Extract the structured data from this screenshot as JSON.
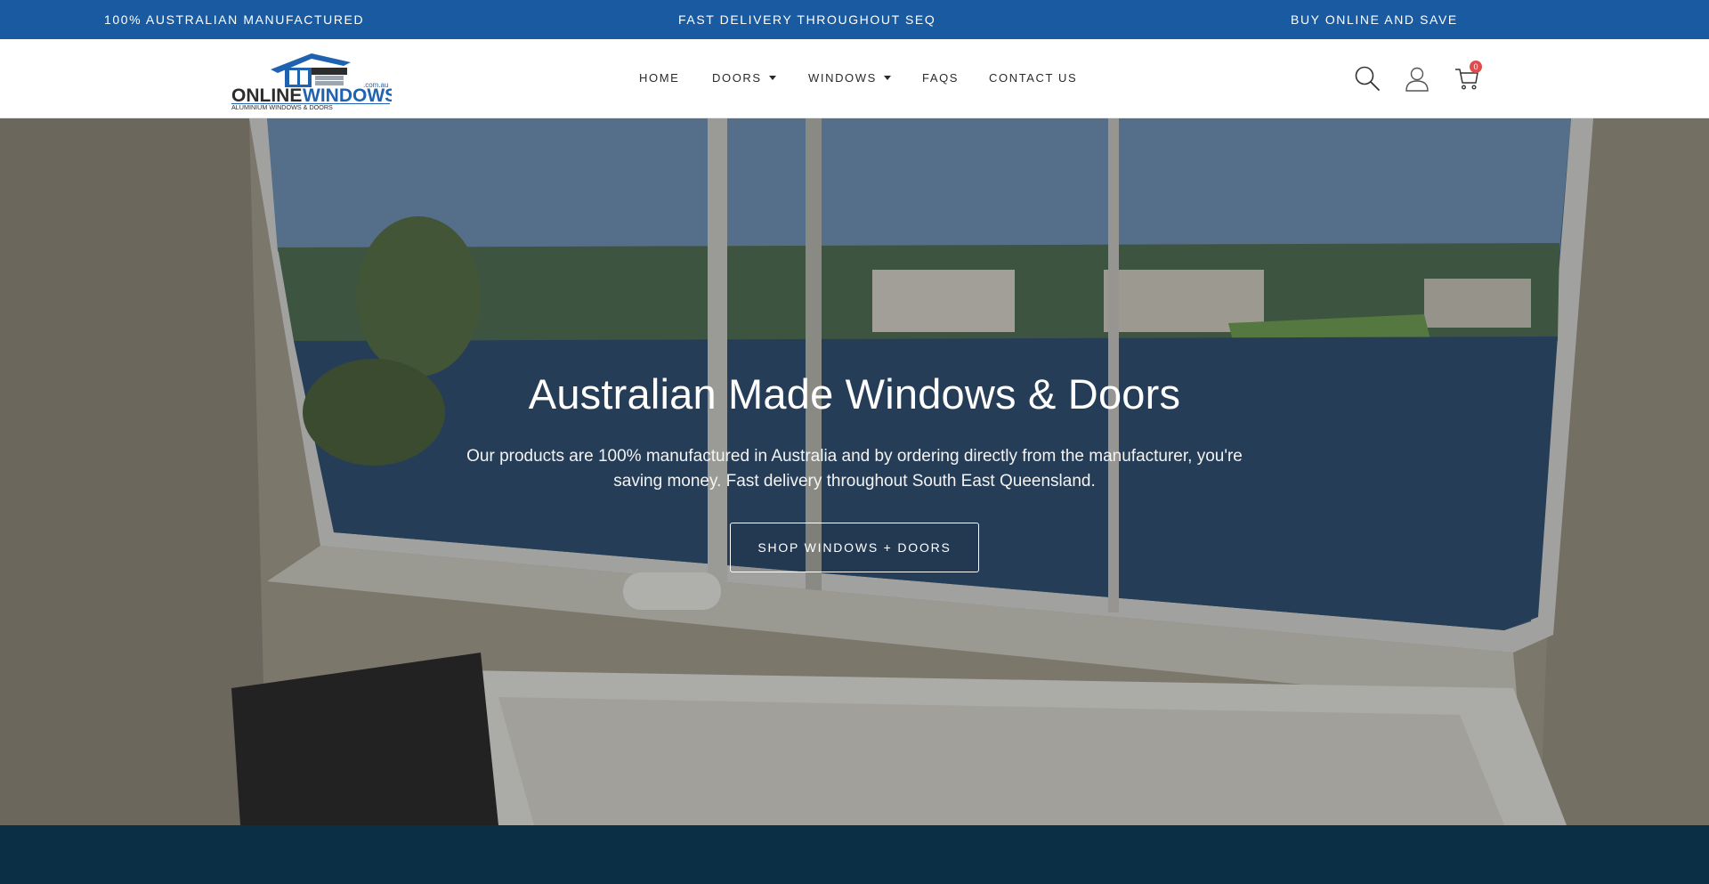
{
  "topbar": {
    "left": "100% Australian Manufactured",
    "center": "Fast Delivery Throughout SEQ",
    "right": "Buy Online and Save"
  },
  "header": {
    "logo": {
      "brand_online": "ONLINE",
      "brand_windows": "WINDOWS",
      "domain": ".com.au",
      "tagline": "ALUMINIUM WINDOWS & DOORS"
    },
    "nav": [
      {
        "label": "Home",
        "has_dropdown": false
      },
      {
        "label": "Doors",
        "has_dropdown": true
      },
      {
        "label": "Windows",
        "has_dropdown": true
      },
      {
        "label": "FAQs",
        "has_dropdown": false
      },
      {
        "label": "Contact Us",
        "has_dropdown": false
      }
    ],
    "icons": {
      "search": "search-icon",
      "account": "user-icon",
      "cart": "cart-icon"
    },
    "cart_count": "0"
  },
  "hero": {
    "title": "Australian Made Windows & Doors",
    "text": "Our products are 100% manufactured in Australia and by ordering directly from the manufacturer, you're saving money. Fast delivery throughout South East Queensland.",
    "cta": "Shop Windows + Doors"
  },
  "colors": {
    "topbar": "#1a5aa0",
    "band": "#0b3046",
    "badge": "#e04b4b",
    "logo_blue": "#1f63b0",
    "logo_dark": "#2c2c2c"
  }
}
